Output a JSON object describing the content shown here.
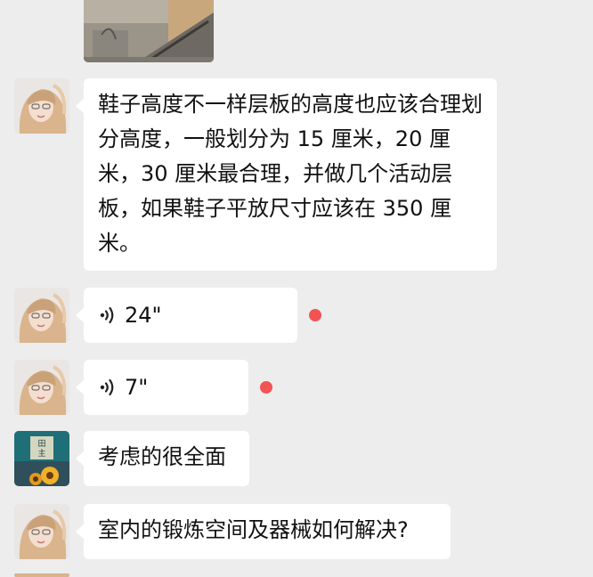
{
  "colors": {
    "background": "#ededed",
    "bubble": "#ffffff",
    "unread_dot": "#f25454"
  },
  "messages": [
    {
      "type": "image",
      "sender": "user-a"
    },
    {
      "type": "text",
      "sender": "user-a",
      "text": "鞋子高度不一样层板的高度也应该合理划分高度，一般划分为 15 厘米，20 厘米，30 厘米最合理，并做几个活动层板，如果鞋子平放尺寸应该在 350 厘米。"
    },
    {
      "type": "voice",
      "sender": "user-a",
      "duration": "24\"",
      "icon": "voice-wave-icon",
      "unread": true
    },
    {
      "type": "voice",
      "sender": "user-a",
      "duration": "7\"",
      "icon": "voice-wave-icon",
      "unread": true
    },
    {
      "type": "text",
      "sender": "user-b",
      "text": "考虑的很全面"
    },
    {
      "type": "text",
      "sender": "user-a",
      "text": "室内的锻炼空间及器械如何解决?"
    }
  ],
  "avatars": {
    "user_b_badge_text": "田\n主"
  }
}
